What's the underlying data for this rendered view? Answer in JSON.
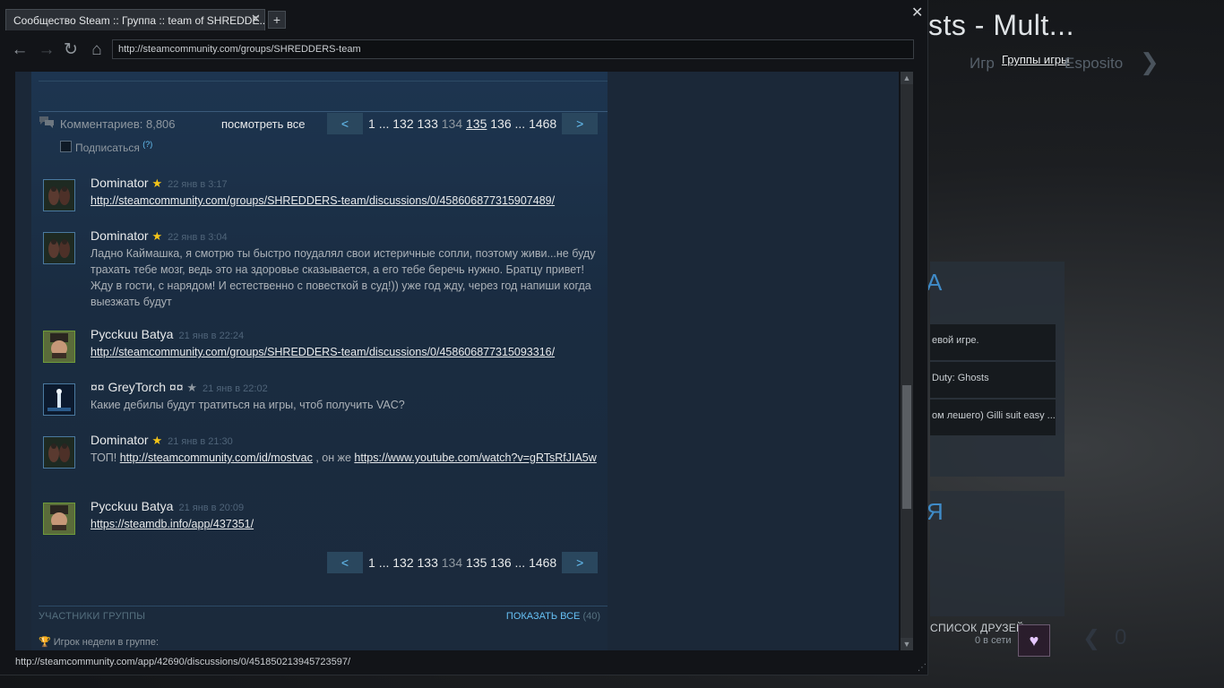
{
  "background": {
    "title": "sts - Mult...",
    "nav_left": "Игр",
    "nav_link": "Группы игры",
    "nav_right": "Esposito",
    "rows": [
      "евой игре.",
      "Duty: Ghosts",
      "ом лешего) Gilli suit easy ..."
    ],
    "friends_label": "СПИСОК ДРУЗЕЙ",
    "friends_count": "0 в сети",
    "counter": "0"
  },
  "window": {
    "tab_title": "Сообщество Steam :: Группа :: team of SHREDDE...",
    "tab_close": "✕",
    "new_tab": "+",
    "close": "✕",
    "url": "http://steamcommunity.com/groups/SHREDDERS-team",
    "status_url": "http://steamcommunity.com/app/42690/discussions/0/451850213945723597/"
  },
  "comments_header": {
    "count_label": "Комментариев: 8,806",
    "view_all": "посмотреть все",
    "subscribe": "Подписаться",
    "subscribe_help": "(?)"
  },
  "pager": {
    "prev": "<",
    "next": ">",
    "first": "1",
    "ellipsis": "...",
    "p132": "132",
    "p133": "133",
    "p134": "134",
    "p135": "135",
    "p136": "136",
    "last": "1468"
  },
  "comments": [
    {
      "author": "Dominator",
      "star": "★",
      "time": "22 янв в 3:17",
      "link": "http://steamcommunity.com/groups/SHREDDERS-team/discussions/0/458606877315907489/"
    },
    {
      "author": "Dominator",
      "star": "★",
      "time": "22 янв в 3:04",
      "text": "Ладно Каймашка, я смотрю ты быстро поудалял свои истеричные сопли, поэтому живи...не буду трахать тебе мозг, ведь это на здоровье сказывается, а его тебе беречь нужно. Братцу привет! Жду в гости, с нарядом! И естественно с повесткой в суд!)) уже год жду, через год напиши когда выезжать будут"
    },
    {
      "author": "Pусckuu Batya",
      "time": "21 янв в 22:24",
      "link": "http://steamcommunity.com/groups/SHREDDERS-team/discussions/0/458606877315093316/"
    },
    {
      "author": "¤¤ GreyTorch ¤¤",
      "star": "★",
      "time": "21 янв в 22:02",
      "text": "Какие дебилы будут тратиться на игры, чтоб получить VAC?"
    },
    {
      "author": "Dominator",
      "star": "★",
      "time": "21 янв в 21:30",
      "prefix": "ТОП! ",
      "link1": "http://steamcommunity.com/id/mostvac",
      "mid": " , он же ",
      "link2": "https://www.youtube.com/watch?v=gRTsRfJIA5w"
    },
    {
      "author": "Pусckuu Batya",
      "time": "21 янв в 20:09",
      "link": "https://steamdb.info/app/437351/"
    }
  ],
  "members": {
    "label": "УЧАСТНИКИ ГРУППЫ",
    "show_all": "ПОКАЗАТЬ ВСЕ",
    "count": "(40)",
    "player_week": "Игрок недели в группе:"
  },
  "colors": {
    "accent": "#66c0f4",
    "bg": "#1b2838",
    "star": "#f5c518"
  }
}
